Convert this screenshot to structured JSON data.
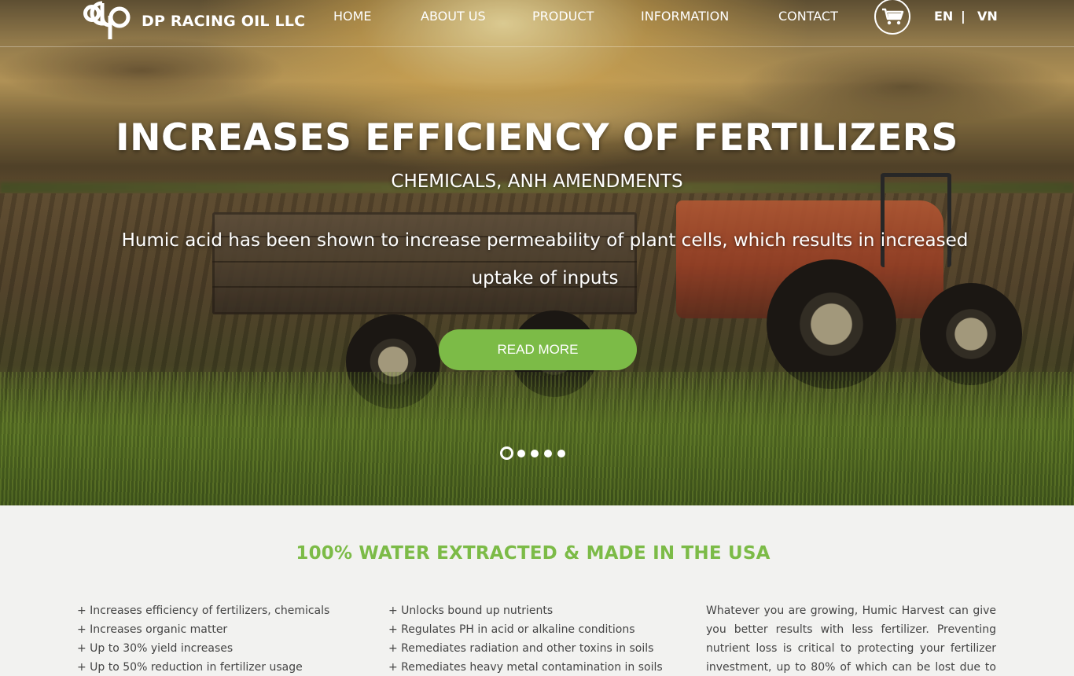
{
  "brand": {
    "name": "DP RACING OIL LLC",
    "logo_icon": "dp-logo-icon"
  },
  "nav": {
    "items": [
      "HOME",
      "ABOUT US",
      "PRODUCT",
      "INFORMATION",
      "CONTACT"
    ]
  },
  "cart": {
    "icon": "cart-icon"
  },
  "lang": {
    "en": "EN",
    "separator": "|",
    "vn": "VN"
  },
  "hero": {
    "title": "INCREASES EFFICIENCY OF FERTILIZERS",
    "subtitle": "CHEMICALS, ANH AMENDMENTS",
    "description": "Humic acid has been shown to increase permeability of plant cells, which results in increased uptake of inputs",
    "button": "READ MORE",
    "slides_total": 5,
    "slide_active": 1
  },
  "content": {
    "title": "100% WATER EXTRACTED & MADE IN THE USA",
    "col1": [
      "+ Increases efficiency of fertilizers, chemicals",
      "+ Increases organic matter",
      "+ Up to 30% yield increases",
      "+ Up to 50% reduction in fertilizer usage"
    ],
    "col2": [
      "+ Unlocks bound up nutrients",
      "+ Regulates PH in acid or alkaline conditions",
      "+ Remediates radiation and other toxins in soils",
      "+ Remediates heavy metal contamination in soils"
    ],
    "col3": "Whatever you are growing, Humic Harvest can give you better results with less fertilizer. Preventing nutrient loss is critical to protecting your fertilizer investment, up to 80% of which can be lost due to runoff, volatilization and"
  },
  "colors": {
    "accent": "#7cbb47",
    "text": "#444444",
    "background": "#f2f2f0"
  }
}
